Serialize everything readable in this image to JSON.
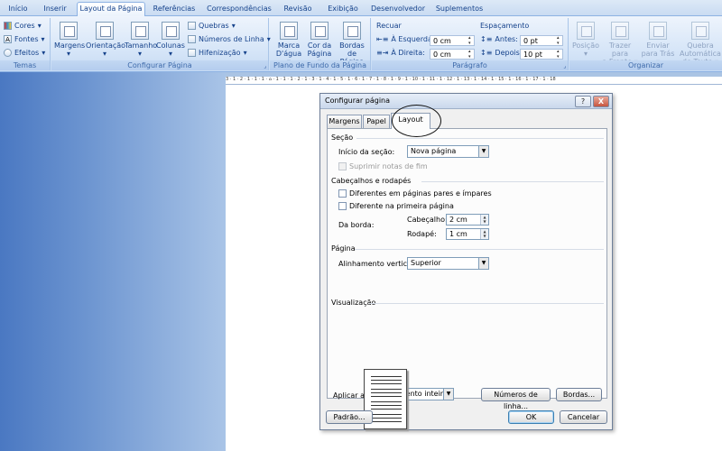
{
  "ribbon": {
    "tabs": [
      "Início",
      "Inserir",
      "Layout da Página",
      "Referências",
      "Correspondências",
      "Revisão",
      "Exibição",
      "Desenvolvedor",
      "Suplementos"
    ],
    "active_tab": "Layout da Página",
    "groups": {
      "temas": {
        "label": "Temas",
        "cores": "Cores",
        "fontes": "Fontes",
        "efeitos": "Efeitos"
      },
      "configurar": {
        "label": "Configurar Página",
        "margens": "Margens",
        "orientacao": "Orientação",
        "tamanho": "Tamanho",
        "colunas": "Colunas",
        "quebras": "Quebras",
        "numeros_linha": "Números de Linha",
        "hifenizacao": "Hifenização"
      },
      "fundo": {
        "label": "Plano de Fundo da Página",
        "marca1": "Marca",
        "marca2": "D'água",
        "cor1": "Cor da",
        "cor2": "Página",
        "bordas1": "Bordas",
        "bordas2": "de Página"
      },
      "paragrafo": {
        "label": "Parágrafo",
        "recuar": "Recuar",
        "esquerda_label": "À Esquerda:",
        "esquerda_value": "0 cm",
        "direita_label": "À Direita:",
        "direita_value": "0 cm",
        "espacamento": "Espaçamento",
        "antes_label": "Antes:",
        "antes_value": "0 pt",
        "depois_label": "Depois:",
        "depois_value": "10 pt"
      },
      "organizar": {
        "label": "Organizar",
        "posicao": "Posição",
        "trazer1": "Trazer para",
        "trazer2": "a Frente",
        "enviar1": "Enviar",
        "enviar2": "para Trás",
        "quebra1": "Quebra Automática",
        "quebra2": "de Texto"
      }
    }
  },
  "ruler": {
    "text": "3 · 1 · 2 · 1 · 1 · 1 · ⌂ · 1 · 1 · 1 · 2 · 1 · 3 · 1 · 4 · 1 · 5 · 1 · 6 · 1 · 7 · 1 · 8 · 1 · 9 · 1 · 10 · 1 · 11 · 1 · 12 · 1 · 13 · 1 · 14 · 1 · 15 · 1 · 16 · 1 · 17 · 1 · 18"
  },
  "dialog": {
    "title": "Configurar página",
    "help": "?",
    "close": "X",
    "tabs": [
      "Margens",
      "Papel",
      "Layout"
    ],
    "active_tab": "Layout",
    "secao": {
      "heading": "Seção",
      "inicio_label": "Início da seção:",
      "inicio_value": "Nova página",
      "suprimir": "Suprimir notas de fim"
    },
    "cabecalhos": {
      "heading": "Cabeçalhos e rodapés",
      "pares_impares": "Diferentes em páginas pares e ímpares",
      "primeira": "Diferente na primeira página",
      "da_borda": "Da borda:",
      "cabecalho_label": "Cabeçalho:",
      "cabecalho_value": "2 cm",
      "rodape_label": "Rodapé:",
      "rodape_value": "1 cm"
    },
    "pagina": {
      "heading": "Página",
      "alinhamento_label": "Alinhamento vertical:",
      "alinhamento_value": "Superior"
    },
    "visualizacao": {
      "heading": "Visualização",
      "aplicar_label": "Aplicar a:",
      "aplicar_value": "No documento inteiro",
      "numeros_linha": "Números de linha...",
      "bordas": "Bordas..."
    },
    "footer": {
      "padrao": "Padrão...",
      "ok": "OK",
      "cancelar": "Cancelar"
    }
  }
}
